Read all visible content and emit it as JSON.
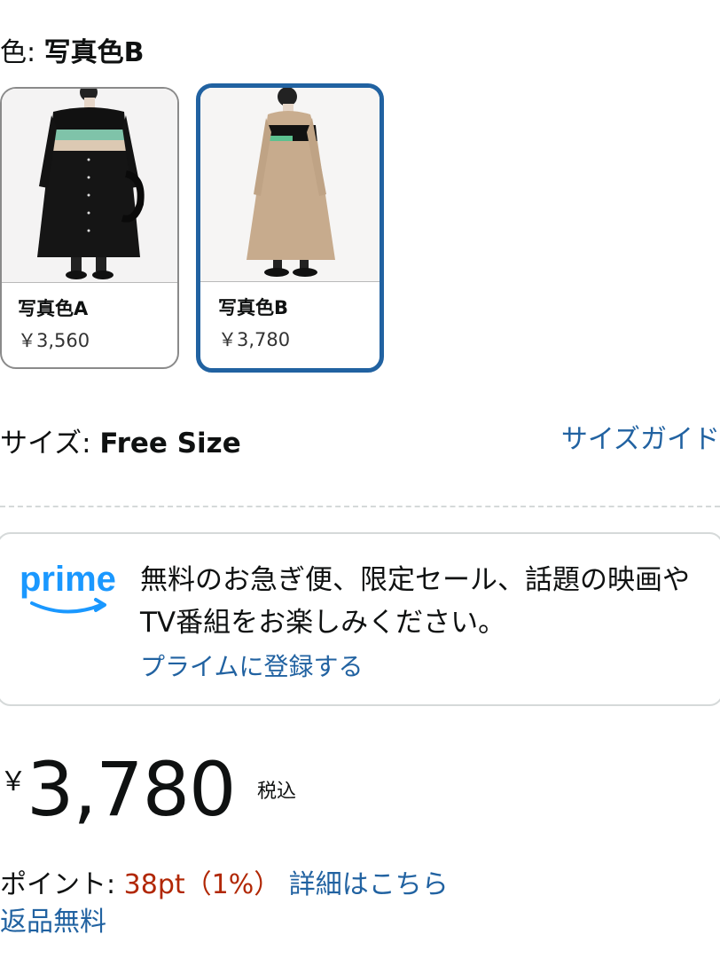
{
  "color": {
    "label": "色: ",
    "value": "写真色B"
  },
  "swatches": [
    {
      "name": "写真色A",
      "price": "￥3,560",
      "selected": false
    },
    {
      "name": "写真色B",
      "price": "￥3,780",
      "selected": true
    }
  ],
  "size": {
    "label": "サイズ: ",
    "value": "Free Size",
    "guide_link": "サイズガイド"
  },
  "prime": {
    "logo_text": "prime",
    "description": "無料のお急ぎ便、限定セール、話題の映画やTV番組をお楽しみください。",
    "link": "プライムに登録する"
  },
  "price": {
    "currency": "￥",
    "amount": "3,780",
    "tax_note": "税込"
  },
  "points": {
    "label": "ポイント: ",
    "value": "38pt（1%）",
    "link": "詳細はこちら"
  },
  "returns": "返品無料",
  "colors": {
    "link": "#2162a1",
    "selected_border": "#2162a1",
    "price_red": "#b12704"
  }
}
